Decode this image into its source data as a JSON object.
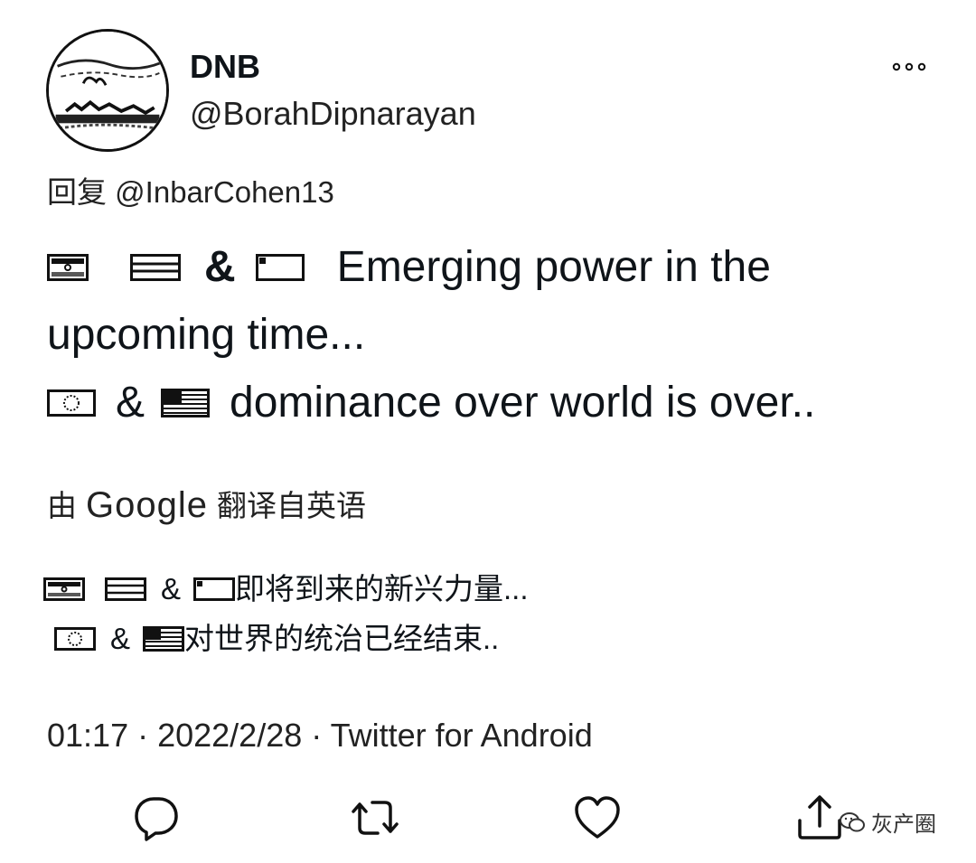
{
  "author": {
    "name": "DNB",
    "handle": "@BorahDipnarayan"
  },
  "reply": {
    "prefix": "回复",
    "mention": "@InbarCohen13"
  },
  "tweet": {
    "line1_amp": "&",
    "line1_text": "Emerging power in the",
    "line2_text": "upcoming time...",
    "line3_amp": "&",
    "line3_text": "dominance over world is over.."
  },
  "translation_note": {
    "prefix": "由",
    "brand": "Google",
    "suffix": "翻译自英语"
  },
  "translation": {
    "line1_amp": "&",
    "line1_text": "即将到来的新兴力量...",
    "line2_amp": "&",
    "line2_text": "对世界的统治已经结束.."
  },
  "meta": {
    "time": "01:17",
    "sep1": " · ",
    "date": "2022/2/28",
    "sep2": " · ",
    "client": "Twitter for Android"
  },
  "watermark": {
    "text": "灰产圈"
  },
  "icons": {
    "more": "more-dots-icon",
    "reply": "reply-bubble-icon",
    "retweet": "retweet-icon",
    "like": "heart-icon",
    "share": "share-upload-icon"
  }
}
